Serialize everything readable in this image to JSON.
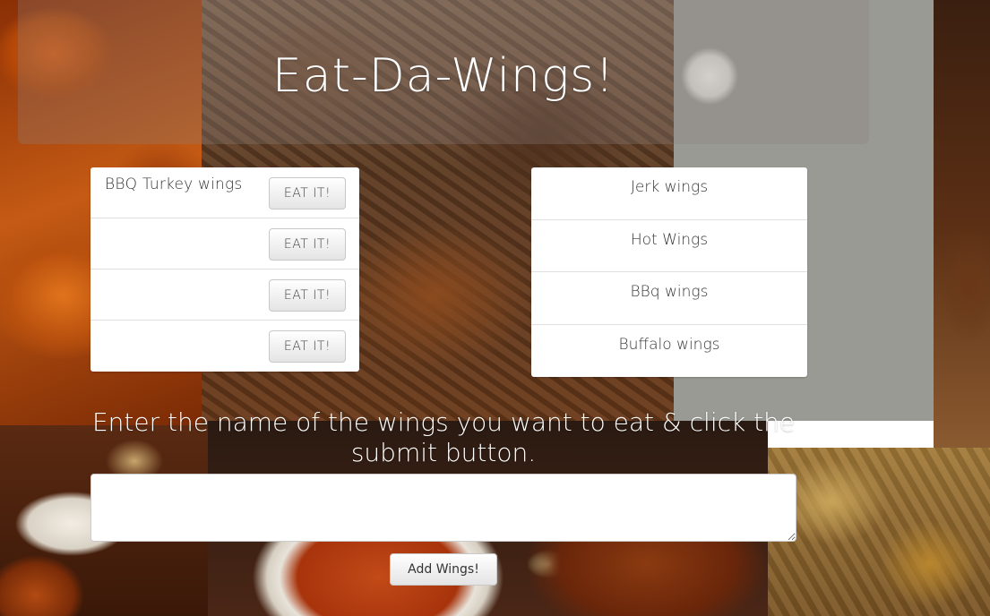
{
  "header": {
    "title": "Eat-Da-Wings!"
  },
  "uneaten": {
    "button_label": "EAT IT!",
    "items": [
      {
        "name": "BBQ Turkey wings"
      },
      {
        "name": ""
      },
      {
        "name": ""
      },
      {
        "name": ""
      }
    ]
  },
  "eaten": {
    "items": [
      {
        "name": "Jerk wings"
      },
      {
        "name": "Hot Wings"
      },
      {
        "name": "BBq wings"
      },
      {
        "name": "Buffalo wings"
      }
    ]
  },
  "form": {
    "instructions": "Enter the name of the wings you want to eat & click the submit button.",
    "input_value": "",
    "submit_label": "Add Wings!"
  }
}
